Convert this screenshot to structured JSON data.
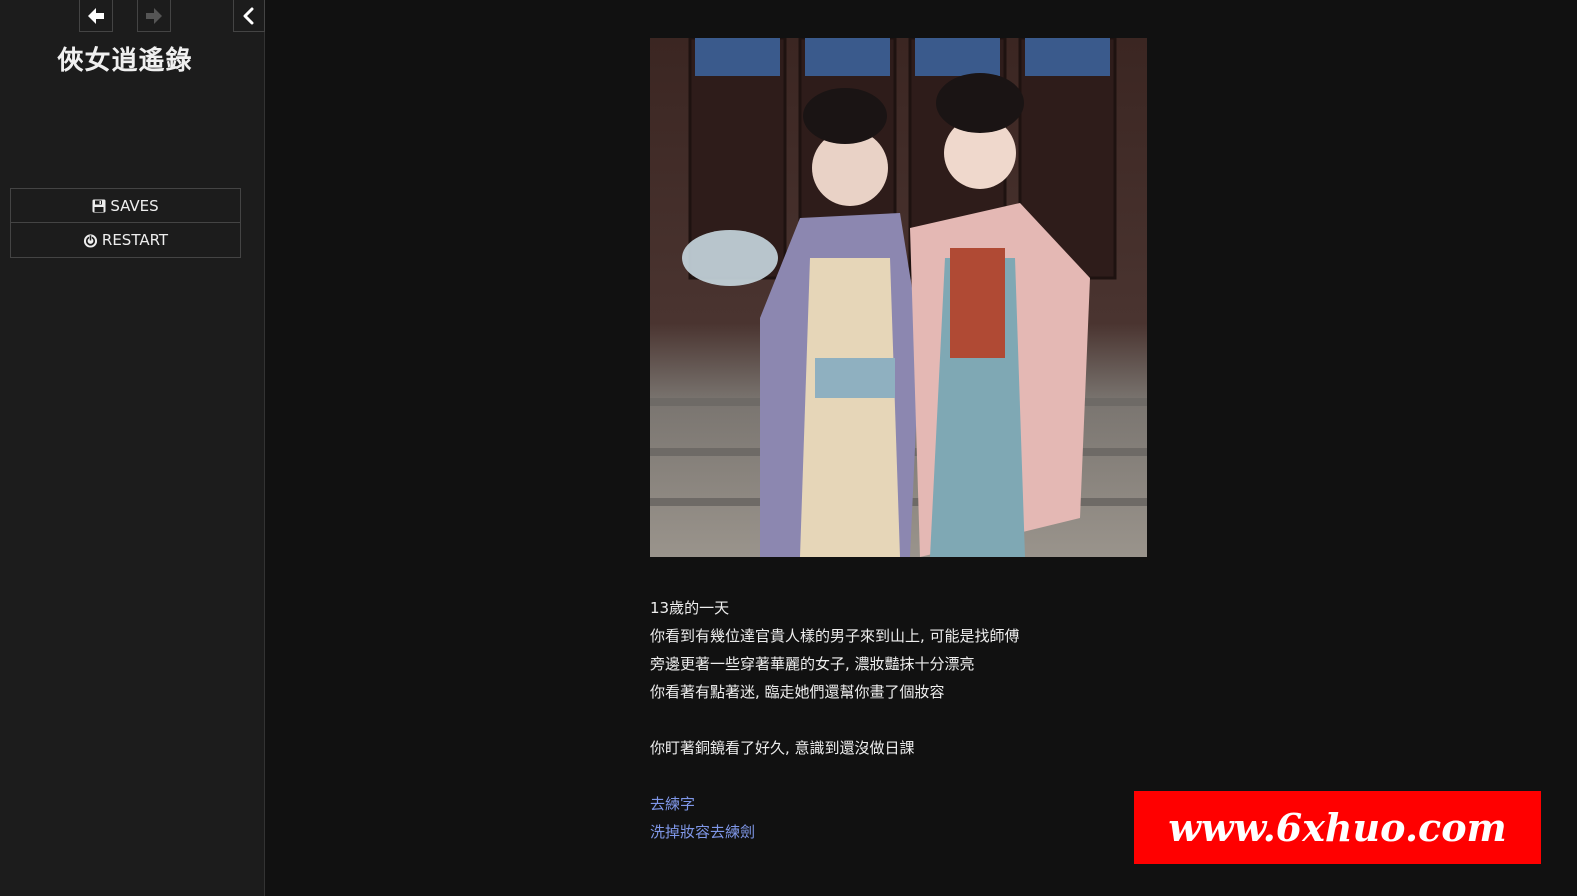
{
  "sidebar": {
    "title": "俠女逍遙錄",
    "back_icon": "arrow-left-icon",
    "forward_icon": "arrow-right-icon",
    "toggle_icon": "chevron-left-icon",
    "menu": [
      {
        "label": "SAVES",
        "icon": "floppy-disk-icon"
      },
      {
        "label": "RESTART",
        "icon": "power-icon"
      }
    ]
  },
  "passage": {
    "lines": [
      "13歲的一天",
      "你看到有幾位達官貴人樣的男子來到山上, 可能是找師傅",
      "旁邊更著一些穿著華麗的女子, 濃妝豔抹十分漂亮",
      "你看著有點著迷, 臨走她們還幫你畫了個妝容",
      "你盯著銅鏡看了好久, 意識到還沒做日課"
    ],
    "links": [
      "去練字",
      "洗掉妝容去練劍"
    ]
  },
  "watermark": "www.6xhuo.com",
  "colors": {
    "background": "#111111",
    "sidebar": "#1c1c1c",
    "link": "#7f97e8",
    "watermark_bg": "#ff0000"
  }
}
